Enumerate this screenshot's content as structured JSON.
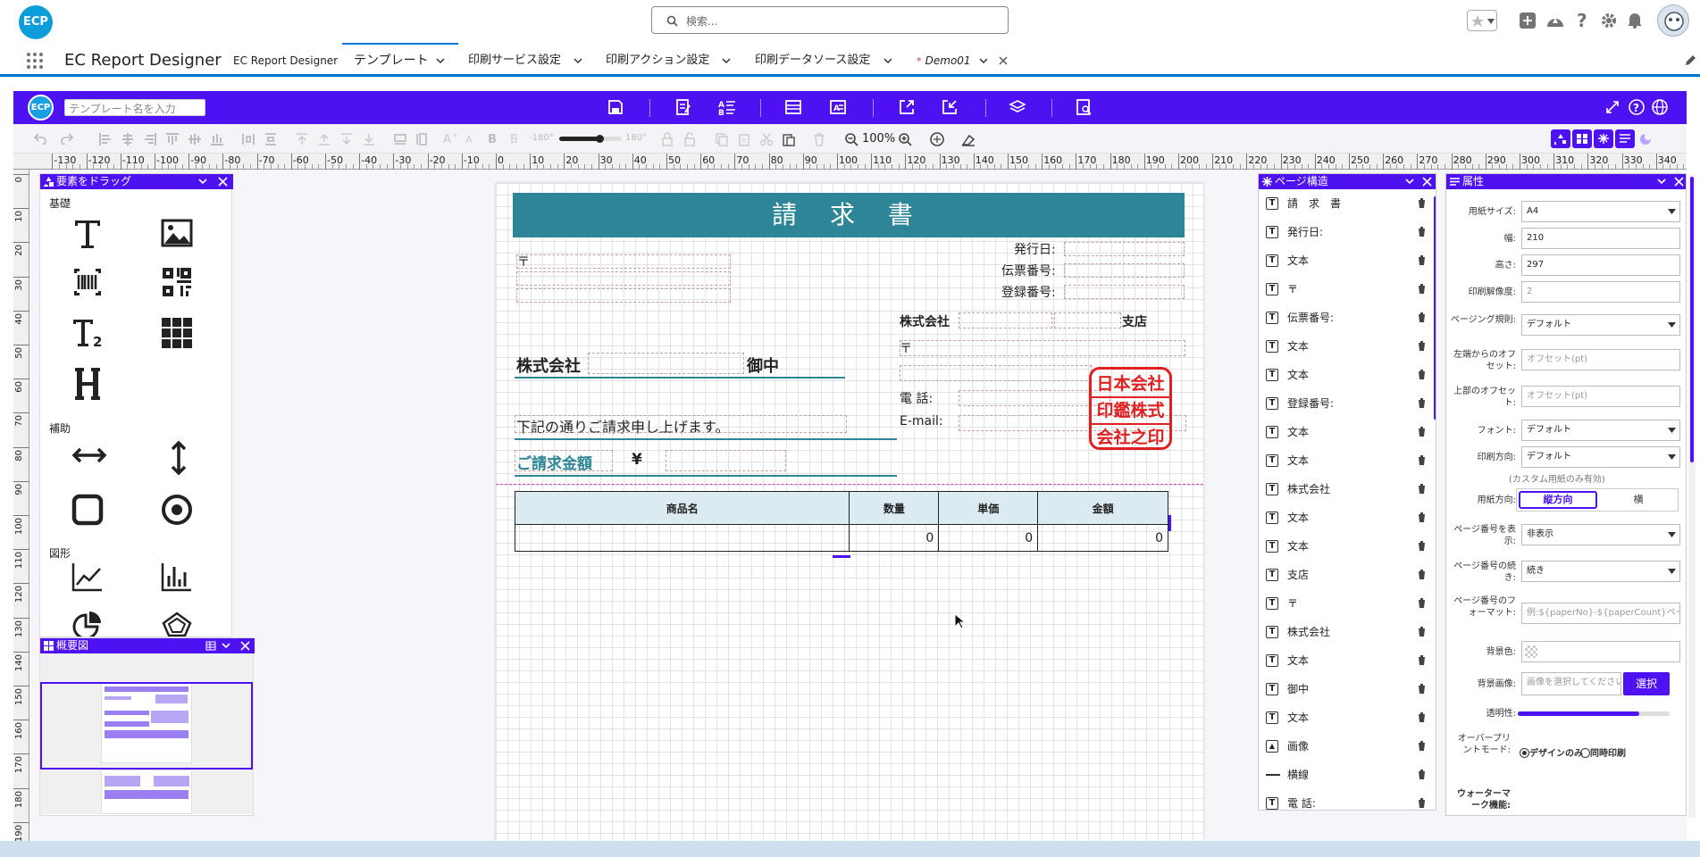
{
  "app": {
    "logo": "ECP",
    "name": "EC Report Designer",
    "search_placeholder": "検索...",
    "tabs": [
      {
        "label": "EC Report Designer"
      },
      {
        "label": "テンプレート"
      },
      {
        "label": "印刷サービス設定"
      },
      {
        "label": "印刷アクション設定"
      },
      {
        "label": "印刷データソース設定"
      },
      {
        "label": "Demo01",
        "marker": "*"
      }
    ]
  },
  "designer": {
    "logo": "ECP",
    "template_name_placeholder": "テンプレート名を入力",
    "rotate_min": "-180°",
    "rotate_max": "180°",
    "zoom": "100%"
  },
  "ruler": {
    "h_ticks": [
      "-130",
      "-120",
      "-110",
      "-100",
      "-90",
      "-80",
      "-70",
      "-60",
      "-50",
      "-40",
      "-30",
      "-20",
      "-10",
      "0",
      "10",
      "20",
      "30",
      "40",
      "50",
      "60",
      "70",
      "80",
      "90",
      "100",
      "110",
      "120",
      "130",
      "140",
      "150",
      "160",
      "170",
      "180",
      "190",
      "200",
      "210",
      "220",
      "230",
      "240",
      "250",
      "260",
      "270",
      "280",
      "290",
      "300",
      "310",
      "320",
      "330",
      "340"
    ],
    "v_ticks": [
      "0",
      "10",
      "20",
      "30",
      "40",
      "50",
      "60",
      "70",
      "80",
      "90",
      "100",
      "110",
      "120",
      "130",
      "140",
      "150",
      "160",
      "170",
      "180",
      "190"
    ]
  },
  "elements_panel": {
    "title": "要素をドラッグ",
    "section_basic": "基礎",
    "section_aux": "補助",
    "section_shape": "図形"
  },
  "overview_panel": {
    "title": "概要図"
  },
  "invoice": {
    "title": "請 求 書",
    "postal": "〒",
    "issue_date": "発行日:",
    "slip_no": "伝票番号:",
    "reg_no": "登録番号:",
    "company": "株式会社",
    "branch": "支店",
    "postal2": "〒",
    "phone": "電 話:",
    "email": "E-mail:",
    "customer_company": "株式会社",
    "honorific": "御中",
    "message": "下記の通りご請求申し上げます。",
    "amount_label": "ご請求金額",
    "yen": "¥",
    "stamp_lines": [
      "日本会社",
      "印鑑株式",
      "会社之印"
    ],
    "table_headers": [
      "商品名",
      "数量",
      "単価",
      "金額"
    ],
    "table_row": [
      "",
      "0",
      "0",
      "0"
    ]
  },
  "structure_panel": {
    "title": "ページ構造",
    "items": [
      {
        "icon": "text",
        "label": "請　求　書"
      },
      {
        "icon": "text",
        "label": "発行日:"
      },
      {
        "icon": "text",
        "label": "文本"
      },
      {
        "icon": "text",
        "label": "〒"
      },
      {
        "icon": "text",
        "label": "伝票番号:"
      },
      {
        "icon": "text",
        "label": "文本"
      },
      {
        "icon": "text",
        "label": "文本"
      },
      {
        "icon": "text",
        "label": "登録番号:"
      },
      {
        "icon": "text",
        "label": "文本"
      },
      {
        "icon": "text",
        "label": "文本"
      },
      {
        "icon": "text",
        "label": "株式会社"
      },
      {
        "icon": "text",
        "label": "文本"
      },
      {
        "icon": "text",
        "label": "文本"
      },
      {
        "icon": "text",
        "label": "支店"
      },
      {
        "icon": "text",
        "label": "〒"
      },
      {
        "icon": "text",
        "label": "株式会社"
      },
      {
        "icon": "text",
        "label": "文本"
      },
      {
        "icon": "text",
        "label": "御中"
      },
      {
        "icon": "text",
        "label": "文本"
      },
      {
        "icon": "image",
        "label": "画像"
      },
      {
        "icon": "hline",
        "label": "横線"
      },
      {
        "icon": "text",
        "label": "電 話:"
      }
    ]
  },
  "props_panel": {
    "title": "属性",
    "paper_size_label": "用紙サイズ:",
    "paper_size": "A4",
    "width_label": "幅:",
    "width": "210",
    "height_label": "高さ:",
    "height": "297",
    "dpi_label": "印刷解像度:",
    "dpi": "2",
    "paging_label": "ページング規則:",
    "paging": "デフォルト",
    "left_offset_label": "左端からのオフセット:",
    "left_offset_ph": "オフセット(pt)",
    "top_offset_label": "上部のオフセット:",
    "top_offset_ph": "オフセット(pt)",
    "font_label": "フォント:",
    "font": "デフォルト",
    "print_dir_label": "印刷方向:",
    "print_dir": "デフォルト",
    "custom_note": "(カスタム用紙のみ有効)",
    "orient_label": "用紙方向:",
    "orient_portrait": "縦方向",
    "orient_landscape": "横",
    "pagenum_show_label": "ページ番号を表示:",
    "pagenum_show": "非表示",
    "pagenum_cont_label": "ページ番号の続き:",
    "pagenum_cont": "続き",
    "pagenum_fmt_label": "ページ番号のフォーマット:",
    "pagenum_fmt_ph": "例:${paperNo}-${paperCount}ページ",
    "bgcolor_label": "背景色:",
    "bgimage_label": "背景画像:",
    "bgimage_ph": "画像を選択してください",
    "select_button": "選択",
    "opacity_label": "透明性:",
    "opacity": 0.8,
    "overprint_label": "オーバープリントモード:",
    "overprint_design": "デザインのみ",
    "overprint_sync": "同時印刷",
    "watermark_label": "ウォーターマーク機能:"
  },
  "colors": {
    "accent": "#4d11f2",
    "salesforce_blue": "#0176d3",
    "title_bar": "#2e8597",
    "stamp_red": "#e02020",
    "table_header": "#dcebf2"
  }
}
